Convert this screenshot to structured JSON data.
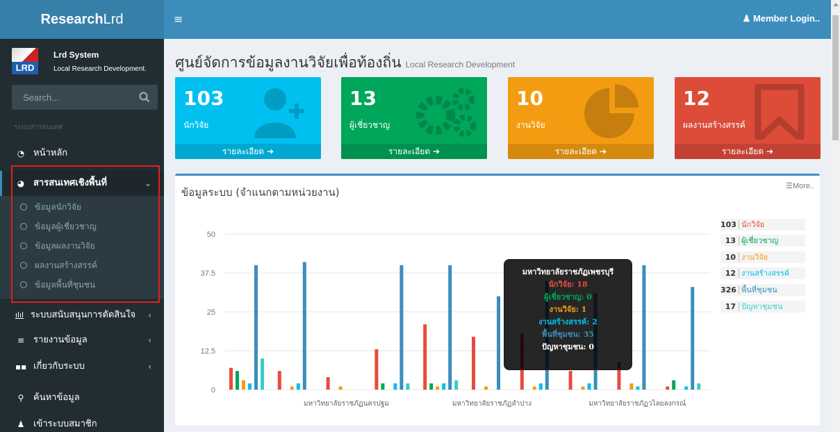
{
  "app": {
    "logo_bold": "Research",
    "logo_rest": "Lrd"
  },
  "user": {
    "badge": "LRD",
    "name": "Lrd System",
    "subtitle": "Local Research Development."
  },
  "search": {
    "placeholder": "Search..."
  },
  "header": {
    "member_login": "Member Login.."
  },
  "sidebar": {
    "section_header": "ระบบสารสนเทศ",
    "items": [
      {
        "label": "หน้าหลัก"
      },
      {
        "label": "สารสนเทศเชิงพื้นที่"
      },
      {
        "label": "ระบบสนับสนุนการตัดสินใจ"
      },
      {
        "label": "รายงานข้อมูล"
      },
      {
        "label": "เกี่ยวกับระบบ"
      },
      {
        "label": "ค้นหาข้อมูล"
      },
      {
        "label": "เข้าระบบสมาชิก"
      }
    ],
    "subitems": [
      {
        "label": "ข้อมูลนักวิจัย"
      },
      {
        "label": "ข้อมูลผู้เชี่ยวชาญ"
      },
      {
        "label": "ข้อมูลผลงานวิจัย"
      },
      {
        "label": "ผลงานสร้างสรรค์"
      },
      {
        "label": "ข้อมูลพื้นที่ชุมชน"
      }
    ]
  },
  "page": {
    "title": "ศูนย์จัดการข้อมูลงานวิจัยเพื่อท้องถิ่น",
    "subtitle": "Local Research Development"
  },
  "boxes": [
    {
      "value": "103",
      "caption": "นักวิจัย",
      "link": "รายละเอียด",
      "color": "#00c0ef"
    },
    {
      "value": "13",
      "caption": "ผู้เชี่ยวชาญ",
      "link": "รายละเอียด",
      "color": "#00a65a"
    },
    {
      "value": "10",
      "caption": "งานวิจัย",
      "link": "รายละเอียด",
      "color": "#f39c12"
    },
    {
      "value": "12",
      "caption": "ผลงานสร้างสรรค์",
      "link": "รายละเอียด",
      "color": "#dd4b39"
    }
  ],
  "panel": {
    "title": "ข้อมูลระบบ (จำแนกตามหน่วยงาน)",
    "more": "More.."
  },
  "legend": [
    {
      "value": "103",
      "name": "นักวิจัย",
      "color": "#e74c3c"
    },
    {
      "value": "13",
      "name": "ผู้เชี่ยวชาญ",
      "color": "#00a65a"
    },
    {
      "value": "10",
      "name": "งานวิจัย",
      "color": "#f39c12"
    },
    {
      "value": "12",
      "name": "งานสร้างสรรค์",
      "color": "#00c0ef"
    },
    {
      "value": "326",
      "name": "พื้นที่ชุมชน",
      "color": "#3c8dbc"
    },
    {
      "value": "17",
      "name": "ปัญหาชุมชน",
      "color": "#39cccc"
    }
  ],
  "tooltip": {
    "title": "มหาวิทยาลัยราชภัฏเพชรบุรี",
    "lines": [
      {
        "text": "นักวิจัย: 18",
        "color": "#e74c3c"
      },
      {
        "text": "ผู้เชี่ยวชาญ: 0",
        "color": "#00a65a"
      },
      {
        "text": "งานวิจัย: 1",
        "color": "#f39c12"
      },
      {
        "text": "งานสร้างสรรค์: 2",
        "color": "#00c0ef"
      },
      {
        "text": "พื้นที่ชุมชน: 35",
        "color": "#3c8dbc"
      },
      {
        "text": "ปัญหาชุมชน: 0",
        "color": "#39cccc"
      }
    ]
  },
  "chart_data": {
    "type": "bar",
    "ylim": [
      0,
      50
    ],
    "yticks": [
      "0",
      "12.5",
      "25",
      "37.5",
      "50"
    ],
    "categories": [
      "",
      "",
      "มหาวิทยาลัยราชภัฏนครปฐม",
      "",
      "",
      "มหาวิทยาลัยราชภัฏลำปาง",
      "",
      "",
      "มหาวิทยาลัยราชภัฏวไลยลงกรณ์",
      ""
    ],
    "series": [
      {
        "name": "นักวิจัย",
        "color": "#e74c3c",
        "values": [
          7,
          6,
          4,
          13,
          21,
          17,
          18,
          6,
          9,
          1
        ]
      },
      {
        "name": "ผู้เชี่ยวชาญ",
        "color": "#00a65a",
        "values": [
          6,
          0,
          0,
          2,
          2,
          0,
          0,
          0,
          0,
          3
        ]
      },
      {
        "name": "งานวิจัย",
        "color": "#f39c12",
        "values": [
          3,
          1,
          1,
          0,
          1,
          1,
          1,
          1,
          2,
          0
        ]
      },
      {
        "name": "งานสร้างสรรค์",
        "color": "#00c0ef",
        "values": [
          2,
          2,
          0,
          2,
          2,
          0,
          2,
          2,
          1,
          1
        ]
      },
      {
        "name": "พื้นที่ชุมชน",
        "color": "#3c8dbc",
        "values": [
          40,
          41,
          0,
          40,
          40,
          30,
          35,
          31,
          40,
          33
        ]
      },
      {
        "name": "ปัญหาชุมชน",
        "color": "#39cccc",
        "values": [
          10,
          0,
          0,
          2,
          3,
          0,
          0,
          0,
          0,
          2
        ]
      }
    ]
  }
}
